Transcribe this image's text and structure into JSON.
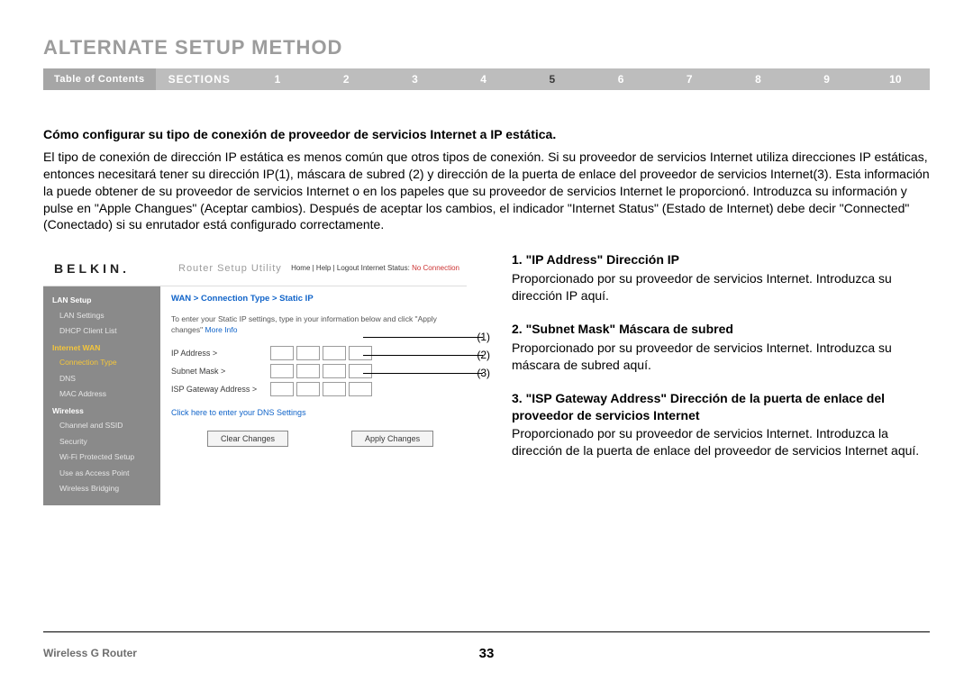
{
  "page_title": "ALTERNATE SETUP METHOD",
  "nav": {
    "toc": "Table of Contents",
    "sections_label": "SECTIONS",
    "numbers": [
      "1",
      "2",
      "3",
      "4",
      "5",
      "6",
      "7",
      "8",
      "9",
      "10"
    ],
    "active": "5"
  },
  "heading": "Cómo configurar su tipo de conexión de proveedor de servicios Internet a IP estática.",
  "paragraph": "El tipo de conexión de dirección IP estática es menos común que otros tipos de conexión. Si su proveedor de servicios Internet utiliza direcciones IP estáticas, entonces necesitará tener su dirección IP(1), máscara de subred (2) y dirección de la puerta de enlace del proveedor de servicios Internet(3). Esta información la puede obtener de su proveedor de servicios Internet o en los papeles que su proveedor de servicios Internet le proporcionó. Introduzca su información y pulse en \"Apple Changues\" (Aceptar cambios). Después de aceptar los cambios, el indicador \"Internet Status\" (Estado de Internet) debe decir \"Connected\" (Conectado) si su enrutador está configurado correctamente.",
  "right_items": [
    {
      "title": "1.    \"IP Address\" Dirección IP",
      "text": "Proporcionado por su proveedor de servicios Internet. Introduzca su dirección IP aquí."
    },
    {
      "title": "2.    \"Subnet Mask\" Máscara de subred",
      "text": "Proporcionado por su proveedor de servicios Internet. Introduzca su máscara de subred aquí."
    },
    {
      "title": "3.    \"ISP Gateway Address\" Dirección de la puerta de enlace del proveedor de servicios Internet",
      "text": "Proporcionado por su proveedor de servicios Internet. Introduzca la dirección de la puerta de enlace del proveedor de servicios Internet aquí."
    }
  ],
  "router": {
    "logo": "BELKIN.",
    "utility": "Router Setup Utility",
    "toplinks": "Home | Help | Logout   Internet Status: ",
    "no_conn": "No Connection",
    "side": {
      "g1": "LAN Setup",
      "g1a": "LAN Settings",
      "g1b": "DHCP Client List",
      "g2": "Internet WAN",
      "g2a": "Connection Type",
      "g2b": "DNS",
      "g2c": "MAC Address",
      "g3": "Wireless",
      "g3a": "Channel and SSID",
      "g3b": "Security",
      "g3c": "Wi-Fi Protected Setup",
      "g3d": "Use as Access Point",
      "g3e": "Wireless Bridging"
    },
    "breadcrumb": "WAN > Connection Type > Static IP",
    "instruction": "To enter your Static IP settings, type in your information below and click \"Apply changes\"  ",
    "more_info": "More Info",
    "fields": {
      "ip": "IP Address >",
      "subnet": "Subnet Mask >",
      "gateway": "ISP Gateway Address >"
    },
    "dns_link": "Click here to enter your DNS Settings",
    "clear_btn": "Clear Changes",
    "apply_btn": "Apply Changes",
    "callouts": {
      "c1": "(1)",
      "c2": "(2)",
      "c3": "(3)"
    }
  },
  "footer": {
    "left": "Wireless G Router",
    "page": "33"
  }
}
